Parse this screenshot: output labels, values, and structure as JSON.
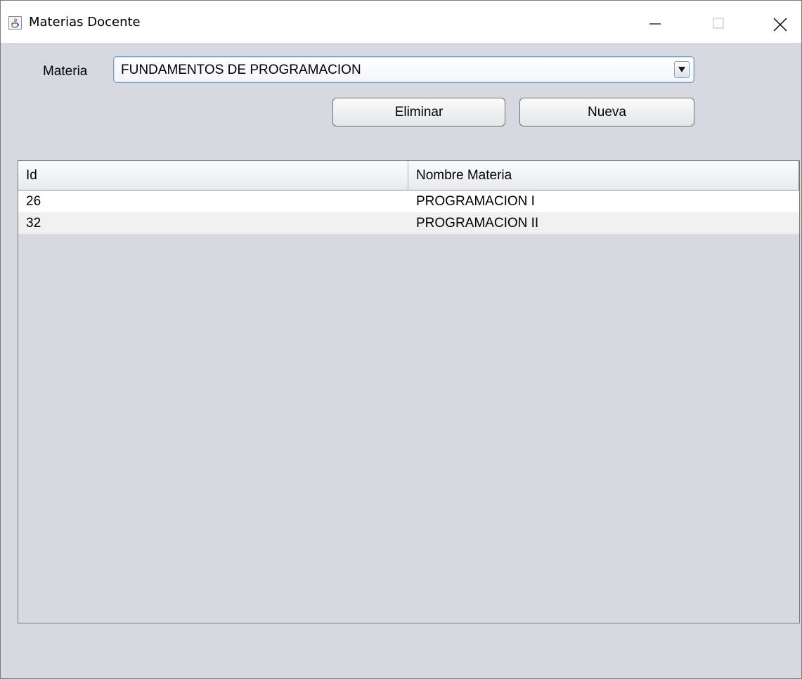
{
  "window": {
    "title": "Materias Docente"
  },
  "form": {
    "materia_label": "Materia",
    "materia_selected": "FUNDAMENTOS DE PROGRAMACION",
    "eliminar_label": "Eliminar",
    "nueva_label": "Nueva"
  },
  "table": {
    "columns": [
      "Id",
      "Nombre Materia"
    ],
    "rows": [
      {
        "id": "26",
        "nombre": "PROGRAMACION I"
      },
      {
        "id": "32",
        "nombre": "PROGRAMACION II"
      }
    ]
  },
  "colors": {
    "window_background": "#d6d9df",
    "row_odd": "#ffffff",
    "row_even": "#f0f0f0"
  },
  "icons": {
    "app": "java-icon",
    "minimize": "minimize-icon",
    "maximize": "maximize-icon",
    "close": "close-icon",
    "dropdown": "chevron-down-icon"
  }
}
